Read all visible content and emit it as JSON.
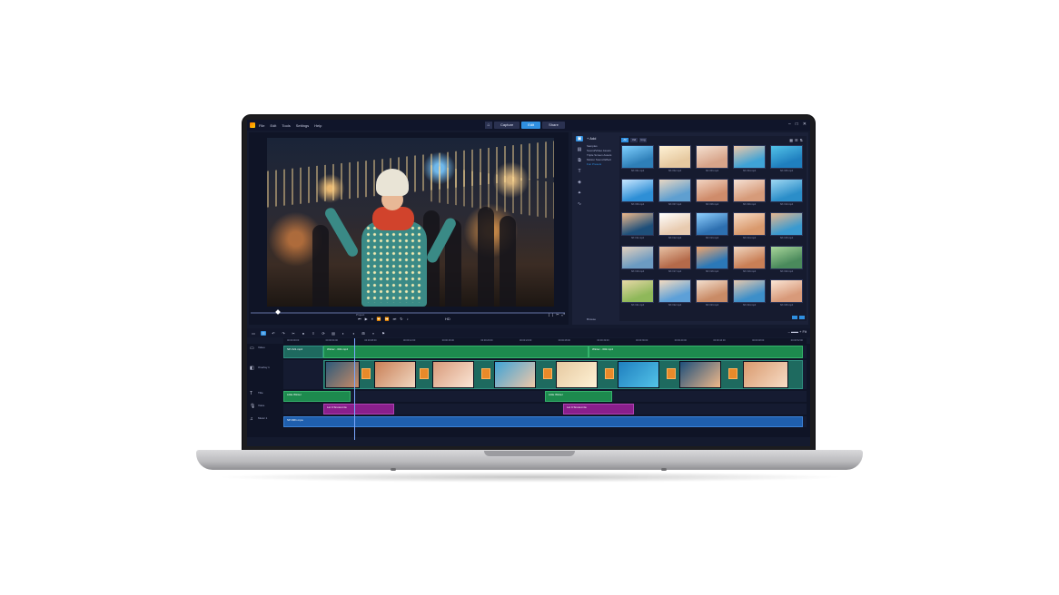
{
  "menubar": {
    "items": [
      "File",
      "Edit",
      "Tools",
      "Settings",
      "Help"
    ],
    "mode_tabs": [
      "Capture",
      "Edit",
      "Share"
    ],
    "active_mode": "Edit"
  },
  "player": {
    "transport_icons": [
      "prev-icon",
      "play-icon",
      "pause-icon",
      "rewind-icon",
      "forward-icon",
      "next-icon"
    ],
    "mode_label": "Project",
    "timecode": "HD"
  },
  "library": {
    "add_label": "Add",
    "folders": [
      "Samples",
      "Sound/Video Assets",
      "Triple Screen Assets",
      "Motion Sound Effect",
      "Fun Presets"
    ],
    "selected_folder": "Fun Presets",
    "browse_label": "Browse",
    "toolbar": [
      "All",
      "Vid",
      "Img"
    ],
    "thumbnails": [
      {
        "label": "SP-V01.mp4",
        "c1": "#2e7fb8",
        "c2": "#7fd0ff"
      },
      {
        "label": "SP-V02.mp4",
        "c1": "#e6c9a0",
        "c2": "#fff2d6"
      },
      {
        "label": "SP-V03.mp4",
        "c1": "#d7a48a",
        "c2": "#f5e1d1"
      },
      {
        "label": "SP-V04.mp4",
        "c1": "#3fa3d6",
        "c2": "#f0c8a8"
      },
      {
        "label": "SP-V05.mp4",
        "c1": "#1f7fbf",
        "c2": "#53c3e8"
      },
      {
        "label": "SP-V06.mp4",
        "c1": "#2e8fd6",
        "c2": "#c9e7ff"
      },
      {
        "label": "SP-V07.mp4",
        "c1": "#5f9fd0",
        "c2": "#e9d7c2"
      },
      {
        "label": "SP-V08.mp4",
        "c1": "#cf8c6b",
        "c2": "#f2d5c3"
      },
      {
        "label": "SP-V09.mp4",
        "c1": "#d69b7a",
        "c2": "#f6e2d5"
      },
      {
        "label": "SP-V10.mp4",
        "c1": "#2b8ec9",
        "c2": "#9fd8f2"
      },
      {
        "label": "SP-V11.mp4",
        "c1": "#1e4f7a",
        "c2": "#f0b98a"
      },
      {
        "label": "SP-V12.mp4",
        "c1": "#e8cbb0",
        "c2": "#ffffff"
      },
      {
        "label": "SP-V13.mp4",
        "c1": "#2d6fb0",
        "c2": "#8fd0ff"
      },
      {
        "label": "SP-V14.mp4",
        "c1": "#d99a6e",
        "c2": "#f7dcc6"
      },
      {
        "label": "SP-V15.mp4",
        "c1": "#3a9ad0",
        "c2": "#e8b78f"
      },
      {
        "label": "SP-V16.mp4",
        "c1": "#6c9bc2",
        "c2": "#e3d0bd"
      },
      {
        "label": "SP-V17.mp4",
        "c1": "#b46a4a",
        "c2": "#e7c2a5"
      },
      {
        "label": "SP-V18.mp4",
        "c1": "#2b78b8",
        "c2": "#f2a56c"
      },
      {
        "label": "SP-V19.mp4",
        "c1": "#c97f56",
        "c2": "#f0d7c1"
      },
      {
        "label": "SP-V20.mp4",
        "c1": "#4a8a5c",
        "c2": "#a9d69a"
      },
      {
        "label": "SP-V21.mp4",
        "c1": "#8fb85a",
        "c2": "#e8d8a8"
      },
      {
        "label": "SP-V22.mp4",
        "c1": "#5da0d8",
        "c2": "#f5dcc0"
      },
      {
        "label": "SP-V23.mp4",
        "c1": "#c98b66",
        "c2": "#f3e0cf"
      },
      {
        "label": "SP-V24.mp4",
        "c1": "#3d8fc9",
        "c2": "#e7c9ad"
      },
      {
        "label": "SP-V25.mp4",
        "c1": "#d89a7a",
        "c2": "#fbe6d6"
      }
    ]
  },
  "timeline": {
    "ruler": [
      "00:00:00:00",
      "00:00:04:00",
      "00:00:08:00",
      "00:00:12:00",
      "00:00:16:00",
      "00:00:20:00",
      "00:00:24:00",
      "00:00:28:00",
      "00:00:32:00",
      "00:00:36:00",
      "00:00:40:00",
      "00:00:44:00",
      "00:00:48:00",
      "00:00:52:00"
    ],
    "tracks": [
      "Video",
      "Overlay 1",
      "Title",
      "Voice",
      "Music 1"
    ],
    "video_clips": [
      "SP-V21.mp4",
      "Winter - 001.mp4",
      "Winter - 002.mp4"
    ],
    "title_clips": [
      "Little Winter",
      "Little Winter"
    ],
    "voice_clips": [
      "Let It Snow.m4a",
      "Let It Snow.m4a"
    ],
    "music_clip": "SP-M01.mpa",
    "zoom": "Fit"
  }
}
